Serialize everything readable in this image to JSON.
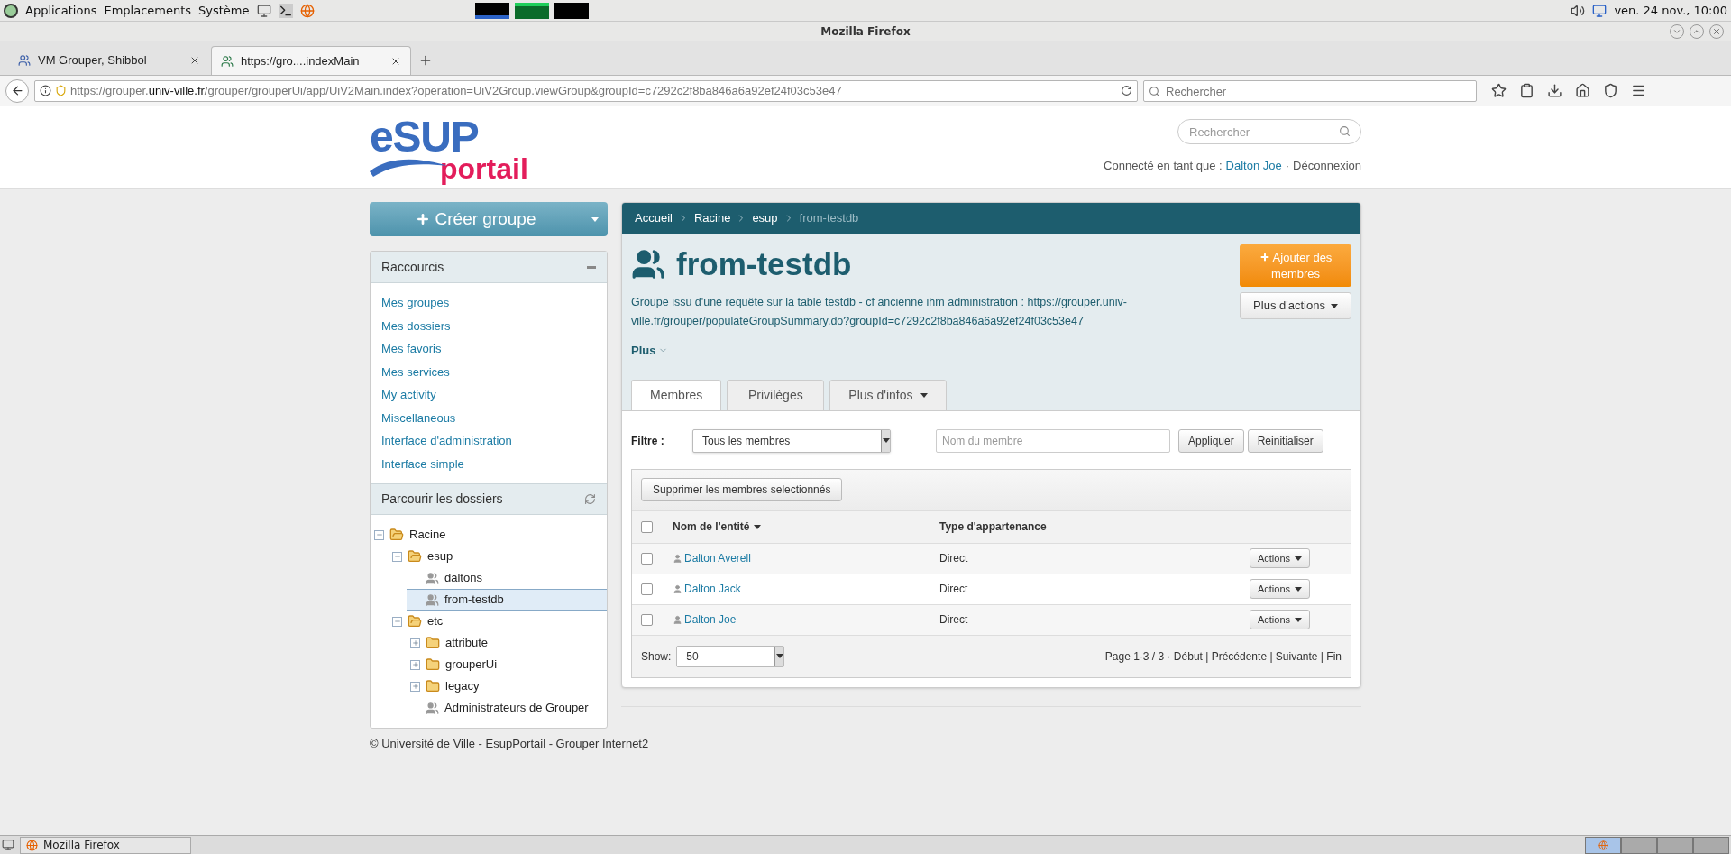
{
  "desktop_panel": {
    "menus": [
      "Applications",
      "Emplacements",
      "Système"
    ],
    "clock": "ven. 24 nov., 10:00"
  },
  "window": {
    "title": "Mozilla Firefox"
  },
  "browser_tabs": [
    {
      "label": "VM Grouper, Shibbol",
      "selected": false
    },
    {
      "label": "https://gro....indexMain",
      "selected": true
    }
  ],
  "address_bar": {
    "url_segments": [
      {
        "text": "https://grouper.",
        "emphasis": false
      },
      {
        "text": "univ-ville.fr",
        "emphasis": true
      },
      {
        "text": "/grouper/grouperUi/app/UiV2Main.index?operation=UiV2Group.viewGroup&groupId=c7292c2f8ba846a6a92ef24f03c53e47",
        "emphasis": false
      }
    ]
  },
  "browser_search": {
    "placeholder": "Rechercher"
  },
  "site_header": {
    "logo_top": "eSUP",
    "logo_bottom": "portail",
    "search_placeholder": "Rechercher",
    "login_label": "Connecté en tant que :",
    "user": "Dalton Joe",
    "separator": "·",
    "logout": "Déconnexion"
  },
  "sidebar": {
    "create_button": "Créer groupe",
    "shortcuts": {
      "title": "Raccourcis",
      "expanded": true,
      "links": [
        "Mes groupes",
        "Mes dossiers",
        "Mes favoris",
        "Mes services",
        "My activity",
        "Miscellaneous",
        "Interface d'administration",
        "Interface simple"
      ]
    },
    "browse": {
      "title": "Parcourir les dossiers",
      "tree": [
        {
          "label": "Racine",
          "kind": "folder",
          "expanded": true,
          "selected": false,
          "children": [
            {
              "label": "esup",
              "kind": "folder",
              "expanded": true,
              "selected": false,
              "children": [
                {
                  "label": "daltons",
                  "kind": "group",
                  "selected": false
                },
                {
                  "label": "from-testdb",
                  "kind": "group",
                  "selected": true
                }
              ]
            },
            {
              "label": "etc",
              "kind": "folder",
              "expanded": true,
              "selected": false,
              "children": [
                {
                  "label": "attribute",
                  "kind": "folder",
                  "expanded": false,
                  "selected": false
                },
                {
                  "label": "grouperUi",
                  "kind": "folder",
                  "expanded": false,
                  "selected": false
                },
                {
                  "label": "legacy",
                  "kind": "folder",
                  "expanded": false,
                  "selected": false
                },
                {
                  "label": "Administrateurs de Grouper",
                  "kind": "group",
                  "selected": false
                }
              ]
            }
          ]
        }
      ]
    }
  },
  "main": {
    "breadcrumb": [
      "Accueil",
      "Racine",
      "esup",
      "from-testdb"
    ],
    "title": "from-testdb",
    "description": "Groupe issu d'une requête sur la table testdb - cf ancienne ihm administration : https://grouper.univ-ville.fr/grouper/populateGroupSummary.do?groupId=c7292c2f8ba846a6a92ef24f03c53e47",
    "more": "Plus",
    "add_button": "Ajouter des membres",
    "more_actions": "Plus d'actions",
    "tabs": [
      {
        "label": "Membres",
        "selected": true,
        "kind": "plain"
      },
      {
        "label": "Privilèges",
        "selected": false,
        "kind": "plain"
      },
      {
        "label": "Plus d'infos",
        "selected": false,
        "kind": "dropdown"
      }
    ],
    "filter": {
      "label": "Filtre :",
      "select": "Tous les membres",
      "name_placeholder": "Nom du membre",
      "apply": "Appliquer",
      "reset": "Reinitialiser"
    },
    "table": {
      "delete_button": "Supprimer les membres selectionnés",
      "all_checked": false,
      "columns": [
        "Nom de l'entité",
        "Type d'appartenance"
      ],
      "rows": [
        {
          "name": "Dalton Averell",
          "membership": "Direct",
          "action": "Actions",
          "checked": false
        },
        {
          "name": "Dalton Jack",
          "membership": "Direct",
          "action": "Actions",
          "checked": false
        },
        {
          "name": "Dalton Joe",
          "membership": "Direct",
          "action": "Actions",
          "checked": false
        }
      ],
      "show_label": "Show:",
      "page_size": "50",
      "pagination": "Page 1-3 / 3 · Début | Précédente | Suivante | Fin"
    }
  },
  "footer": "© Université de Ville - EsupPortail - Grouper Internet2",
  "taskbar": {
    "items": [
      {
        "label": "Mozilla Firefox",
        "selected": false
      }
    ]
  }
}
